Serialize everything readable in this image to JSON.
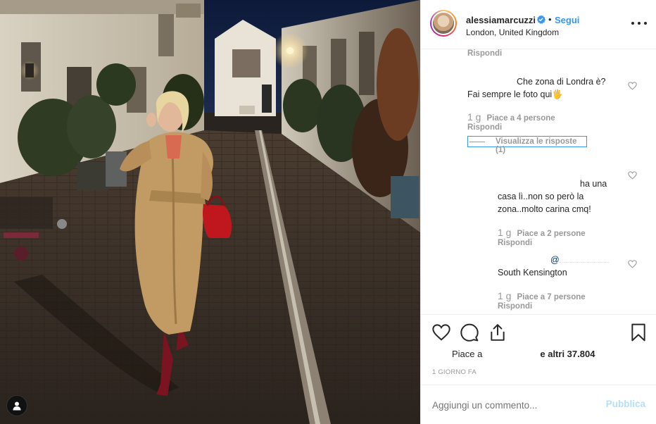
{
  "post": {
    "username": "alessiamarcuzzi",
    "follow_label": "Segui",
    "location": "London, United Kingdom"
  },
  "comments": {
    "top_reply_label": "Rispondi",
    "c1": {
      "text_line1": "Che zona di Londra è?",
      "text_line2": "Fai sempre le foto qui🖐",
      "age": "1 g",
      "likes": "Piace a 4 persone",
      "reply_label": "Rispondi",
      "view_replies": "Visualizza le risposte (1)"
    },
    "c2": {
      "text_line1": "ha una",
      "text_line2": "casa lì..non so però la",
      "text_line3": "zona..molto carina cmq!",
      "age": "1 g",
      "likes": "Piace a 2 persone",
      "reply_label": "Rispondi"
    },
    "c3": {
      "mention": "@",
      "text": "South Kensington",
      "age": "1 g",
      "likes": "Piace a 7 persone",
      "reply_label": "Rispondi"
    }
  },
  "actions": {
    "likes_prefix": "Piace a",
    "likes_suffix": "e altri 37.804",
    "time_ago": "1 GIORNO FA"
  },
  "composer": {
    "placeholder": "Aggiungi un commento...",
    "publish_label": "Pubblica"
  },
  "colors": {
    "accent": "#3897f0",
    "muted": "#999999",
    "publish_disabled": "#b2dffc"
  },
  "icons": {
    "verified": "verified-badge-icon",
    "more": "more-options-icon",
    "heart": "heart-icon",
    "comment": "comment-icon",
    "share": "share-icon",
    "save": "bookmark-icon",
    "user_tag": "user-tag-icon"
  }
}
